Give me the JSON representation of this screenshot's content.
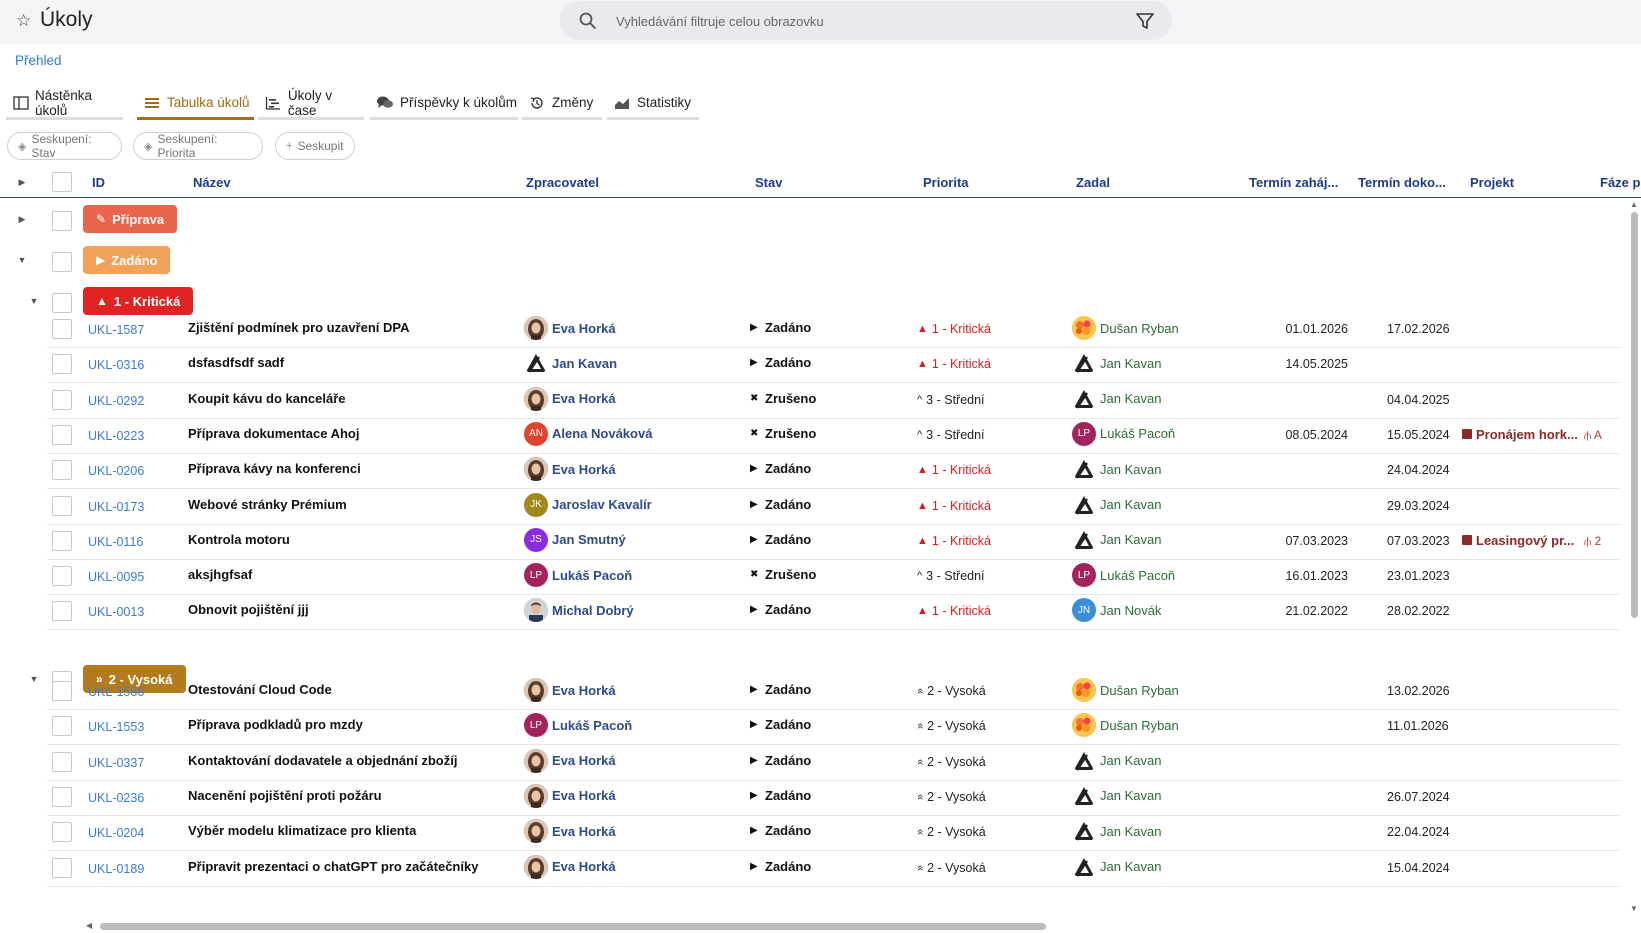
{
  "app": {
    "title": "Úkoly"
  },
  "search": {
    "placeholder": "Vyhledávání filtruje celou obrazovku"
  },
  "breadcrumb": "Přehled",
  "tabs": [
    {
      "label": "Nástěnka úkolů",
      "icon": "board-icon",
      "active": false
    },
    {
      "label": "Tabulka úkolů",
      "icon": "table-icon",
      "active": true
    },
    {
      "label": "Úkoly v čase",
      "icon": "timeline-icon",
      "active": false
    },
    {
      "label": "Příspěvky k úkolům",
      "icon": "comments-icon",
      "active": false
    },
    {
      "label": "Změny",
      "icon": "history-icon",
      "active": false
    },
    {
      "label": "Statistiky",
      "icon": "chart-icon",
      "active": false
    }
  ],
  "chips": [
    {
      "label": "Seskupení: Stav",
      "icon": "layers-icon"
    },
    {
      "label": "Seskupení: Priorita",
      "icon": "layers-icon"
    },
    {
      "label": "Seskupit",
      "icon": "plus-icon"
    }
  ],
  "columns": {
    "id": "ID",
    "name": "Název",
    "assignee": "Zpracovatel",
    "state": "Stav",
    "priority": "Priorita",
    "creator": "Zadal",
    "start": "Termín zaháj...",
    "end": "Termín doko...",
    "project": "Projekt",
    "phase": "Fáze p"
  },
  "colors": {
    "accent": "#a86f10",
    "header_text": "#1e3a8a",
    "link": "#3d7ccc",
    "critical": "#e02424",
    "priprava": "#e8664c",
    "zadano": "#f2a15a",
    "vysoka": "#b47a1e"
  },
  "groups": {
    "priprava": {
      "label": "Příprava",
      "icon": "pencil-icon"
    },
    "zadano": {
      "label": "Zadáno",
      "icon": "play-icon"
    },
    "kriticka": {
      "label": "1 - Kritická",
      "icon": "warning-icon"
    },
    "vysoka": {
      "label": "2 - Vysoká",
      "icon": "double-chevron-up-icon"
    }
  },
  "rows_critical": [
    {
      "id": "UKL-1587",
      "name": "Zjištění podmínek pro uzavření DPA",
      "assignee": "Eva Horká",
      "assignee_avatar": "photo",
      "state": "Zadáno",
      "state_icon": "play",
      "priority": "1 - Kritická",
      "priority_level": "critical",
      "creator": "Dušan Ryban",
      "creator_avatar": "flower",
      "start": "01.01.2026",
      "end": "17.02.2026",
      "project": "",
      "phase": ""
    },
    {
      "id": "UKL-0316",
      "name": "dsfasdfsdf sadf",
      "assignee": "Jan Kavan",
      "assignee_avatar": "logo",
      "state": "Zadáno",
      "state_icon": "play",
      "priority": "1 - Kritická",
      "priority_level": "critical",
      "creator": "Jan Kavan",
      "creator_avatar": "logo",
      "start": "14.05.2025",
      "end": "",
      "project": "",
      "phase": ""
    },
    {
      "id": "UKL-0292",
      "name": "Koupit kávu do kanceláře",
      "assignee": "Eva Horká",
      "assignee_avatar": "photo",
      "state": "Zrušeno",
      "state_icon": "cross",
      "priority": "3 - Střední",
      "priority_level": "medium",
      "creator": "Jan Kavan",
      "creator_avatar": "logo",
      "start": "",
      "end": "04.04.2025",
      "project": "",
      "phase": ""
    },
    {
      "id": "UKL-0223",
      "name": "Příprava dokumentace Ahoj",
      "assignee": "Alena Nováková",
      "assignee_avatar": "AN",
      "assignee_color": "#e0442c",
      "state": "Zrušeno",
      "state_icon": "cross",
      "priority": "3 - Střední",
      "priority_level": "medium",
      "creator": "Lukáš Pacoň",
      "creator_avatar": "LP",
      "creator_color": "#a3245c",
      "start": "08.05.2024",
      "end": "15.05.2024",
      "project": "Pronájem hork...",
      "phase": "A"
    },
    {
      "id": "UKL-0206",
      "name": "Příprava kávy na konferenci",
      "assignee": "Eva Horká",
      "assignee_avatar": "photo",
      "state": "Zadáno",
      "state_icon": "play",
      "priority": "1 - Kritická",
      "priority_level": "critical",
      "creator": "Jan Kavan",
      "creator_avatar": "logo",
      "start": "",
      "end": "24.04.2024",
      "project": "",
      "phase": ""
    },
    {
      "id": "UKL-0173",
      "name": "Webové stránky Prémium",
      "assignee": "Jaroslav Kavalír",
      "assignee_avatar": "JK",
      "assignee_color": "#a08a1c",
      "state": "Zadáno",
      "state_icon": "play",
      "priority": "1 - Kritická",
      "priority_level": "critical",
      "creator": "Jan Kavan",
      "creator_avatar": "logo",
      "start": "",
      "end": "29.03.2024",
      "project": "",
      "phase": ""
    },
    {
      "id": "UKL-0116",
      "name": "Kontrola motoru",
      "assignee": "Jan Smutný",
      "assignee_avatar": "JS",
      "assignee_color": "#8a2be2",
      "state": "Zadáno",
      "state_icon": "play",
      "priority": "1 - Kritická",
      "priority_level": "critical",
      "creator": "Jan Kavan",
      "creator_avatar": "logo",
      "start": "07.03.2023",
      "end": "07.03.2023",
      "project": "Leasingový pr...",
      "phase": "2"
    },
    {
      "id": "UKL-0095",
      "name": "aksjhgfsaf",
      "assignee": "Lukáš Pacoň",
      "assignee_avatar": "LP",
      "assignee_color": "#a3245c",
      "state": "Zrušeno",
      "state_icon": "cross",
      "priority": "3 - Střední",
      "priority_level": "medium",
      "creator": "Lukáš Pacoň",
      "creator_avatar": "LP",
      "creator_color": "#a3245c",
      "start": "16.01.2023",
      "end": "23.01.2023",
      "project": "",
      "phase": ""
    },
    {
      "id": "UKL-0013",
      "name": "Obnovit pojištění jjj",
      "assignee": "Michal Dobrý",
      "assignee_avatar": "photo2",
      "state": "Zadáno",
      "state_icon": "play",
      "priority": "1 - Kritická",
      "priority_level": "critical",
      "creator": "Jan Novák",
      "creator_avatar": "JN",
      "creator_color": "#3a8fd8",
      "start": "21.02.2022",
      "end": "28.02.2022",
      "project": "",
      "phase": ""
    }
  ],
  "rows_high": [
    {
      "id": "UKL-1586",
      "name": "Otestování Cloud Code",
      "assignee": "Eva Horká",
      "assignee_avatar": "photo",
      "state": "Zadáno",
      "state_icon": "play",
      "priority": "2 - Vysoká",
      "priority_level": "high",
      "creator": "Dušan Ryban",
      "creator_avatar": "flower",
      "start": "",
      "end": "13.02.2026",
      "project": "",
      "phase": ""
    },
    {
      "id": "UKL-1553",
      "name": "Příprava podkladů pro mzdy",
      "assignee": "Lukáš Pacoň",
      "assignee_avatar": "LP",
      "assignee_color": "#a3245c",
      "state": "Zadáno",
      "state_icon": "play",
      "priority": "2 - Vysoká",
      "priority_level": "high",
      "creator": "Dušan Ryban",
      "creator_avatar": "flower",
      "start": "",
      "end": "11.01.2026",
      "project": "",
      "phase": ""
    },
    {
      "id": "UKL-0337",
      "name": "Kontaktování dodavatele a objednání zbožíj",
      "assignee": "Eva Horká",
      "assignee_avatar": "photo",
      "state": "Zadáno",
      "state_icon": "play",
      "priority": "2 - Vysoká",
      "priority_level": "high",
      "creator": "Jan Kavan",
      "creator_avatar": "logo",
      "start": "",
      "end": "",
      "project": "",
      "phase": ""
    },
    {
      "id": "UKL-0236",
      "name": "Nacenění pojištění proti požáru",
      "assignee": "Eva Horká",
      "assignee_avatar": "photo",
      "state": "Zadáno",
      "state_icon": "play",
      "priority": "2 - Vysoká",
      "priority_level": "high",
      "creator": "Jan Kavan",
      "creator_avatar": "logo",
      "start": "",
      "end": "26.07.2024",
      "project": "",
      "phase": ""
    },
    {
      "id": "UKL-0204",
      "name": "Výběr modelu klimatizace pro klienta",
      "assignee": "Eva Horká",
      "assignee_avatar": "photo",
      "state": "Zadáno",
      "state_icon": "play",
      "priority": "2 - Vysoká",
      "priority_level": "high",
      "creator": "Jan Kavan",
      "creator_avatar": "logo",
      "start": "",
      "end": "22.04.2024",
      "project": "",
      "phase": ""
    },
    {
      "id": "UKL-0189",
      "name": "Připravit prezentaci o chatGPT pro začátečníky",
      "assignee": "Eva Horká",
      "assignee_avatar": "photo",
      "state": "Zadáno",
      "state_icon": "play",
      "priority": "2 - Vysoká",
      "priority_level": "high",
      "creator": "Jan Kavan",
      "creator_avatar": "logo",
      "start": "",
      "end": "15.04.2024",
      "project": "",
      "phase": ""
    }
  ]
}
